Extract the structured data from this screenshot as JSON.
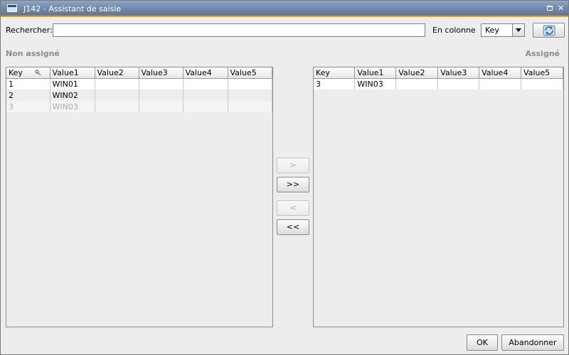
{
  "window": {
    "title": "J142 - Assistant de saisie"
  },
  "search": {
    "label": "Rechercher:",
    "value": "",
    "placeholder": ""
  },
  "column_filter": {
    "label": "En colonne",
    "selected": "Key"
  },
  "sections": {
    "unassigned": "Non assigné",
    "assigned": "Assigné"
  },
  "left_table": {
    "columns": [
      "Key",
      "Value1",
      "Value2",
      "Value3",
      "Value4",
      "Value5"
    ],
    "rows": [
      {
        "cells": [
          "1",
          "WIN01",
          "",
          "",
          "",
          ""
        ],
        "disabled": false
      },
      {
        "cells": [
          "2",
          "WIN02",
          "",
          "",
          "",
          ""
        ],
        "disabled": false
      },
      {
        "cells": [
          "3",
          "WIN03",
          "",
          "",
          "",
          ""
        ],
        "disabled": true
      }
    ]
  },
  "right_table": {
    "columns": [
      "Key",
      "Value1",
      "Value2",
      "Value3",
      "Value4",
      "Value5"
    ],
    "rows": [
      {
        "cells": [
          "3",
          "WIN03",
          "",
          "",
          "",
          ""
        ],
        "disabled": false
      }
    ]
  },
  "transfer": {
    "add_one": ">",
    "add_all": ">>",
    "remove_one": "<",
    "remove_all": "<<"
  },
  "buttons": {
    "ok": "OK",
    "cancel": "Abandonner"
  }
}
